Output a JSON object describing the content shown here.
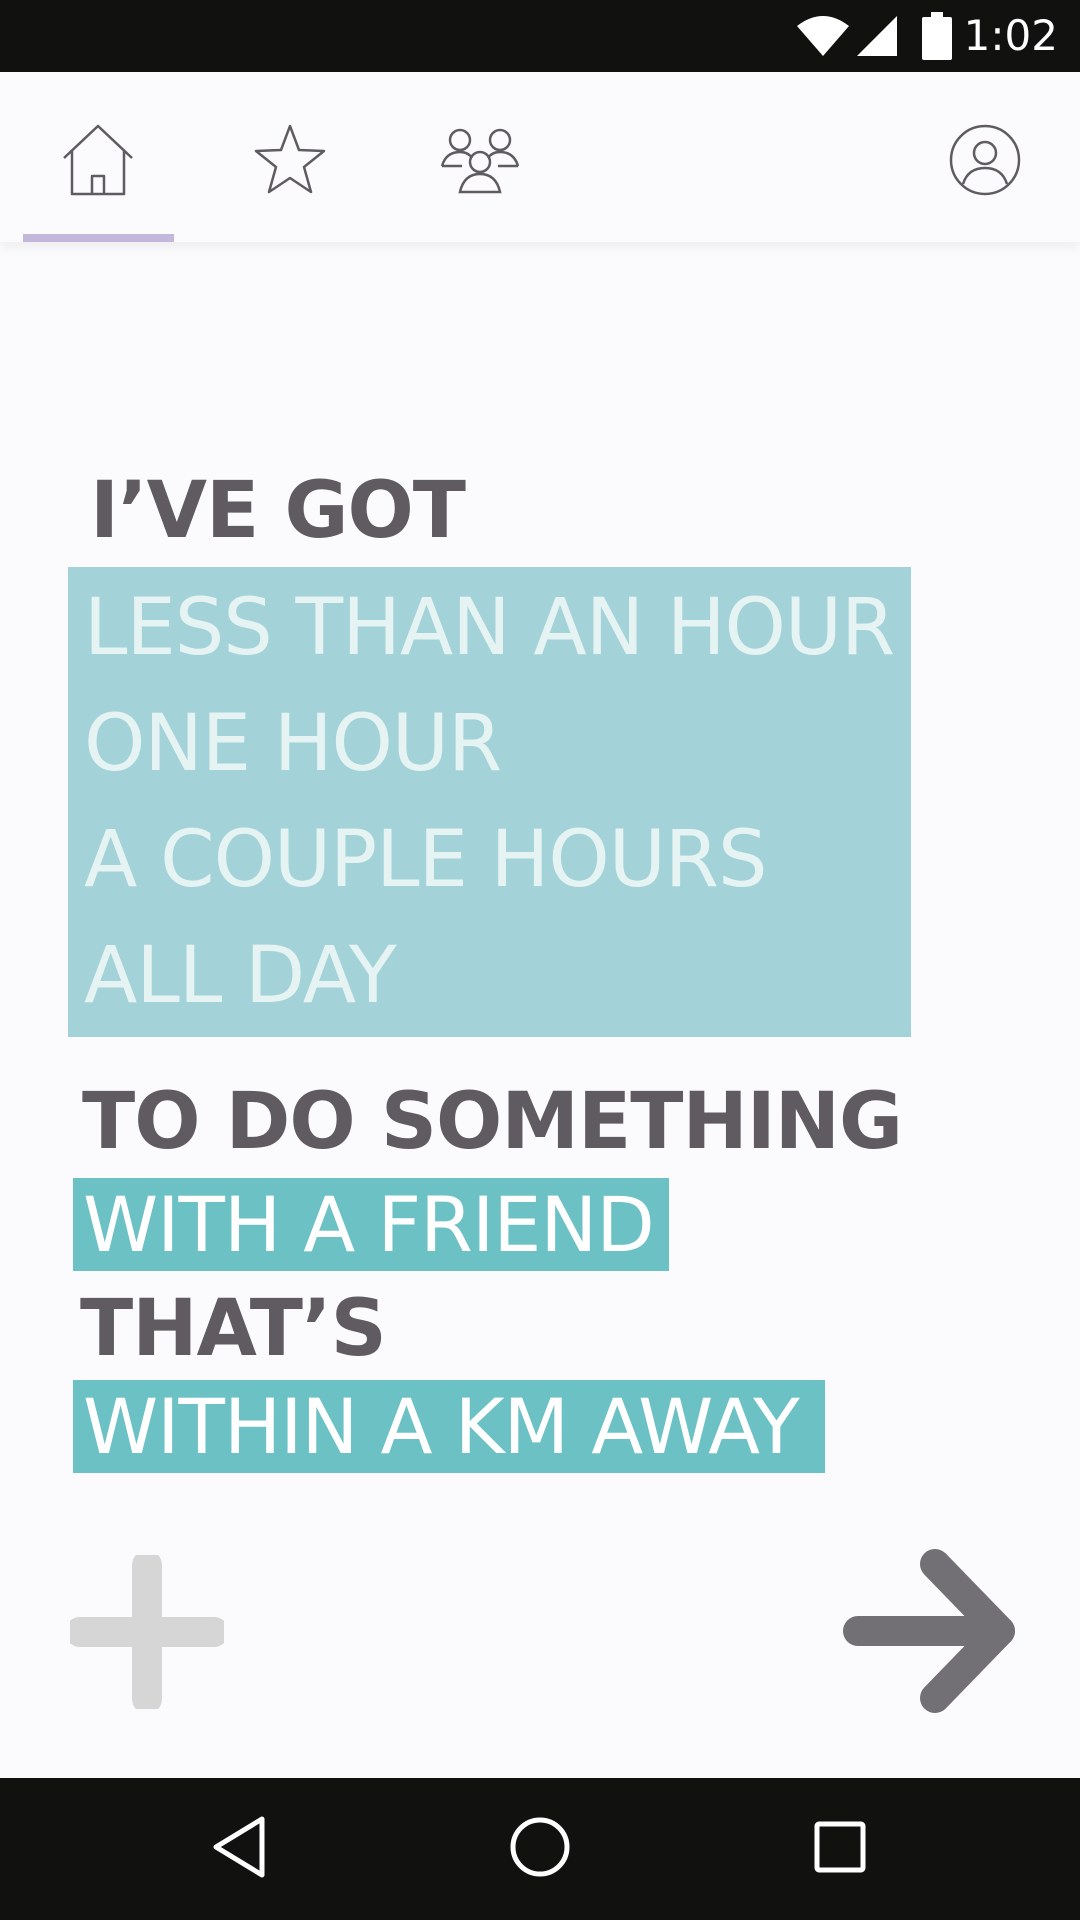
{
  "status_bar": {
    "time": "1:02",
    "icons": [
      "wifi-icon",
      "cellular-signal-icon",
      "battery-icon"
    ]
  },
  "top_nav": {
    "tabs": [
      {
        "icon": "home-icon",
        "active": true
      },
      {
        "icon": "star-icon",
        "active": false
      },
      {
        "icon": "group-icon",
        "active": false
      }
    ],
    "profile_icon": "profile-icon",
    "active_indicator_color": "#c3b8dc"
  },
  "main": {
    "heading_1": "I’VE GOT",
    "time_options": [
      "LESS THAN AN HOUR",
      "ONE HOUR",
      "A COUPLE HOURS",
      "ALL DAY"
    ],
    "heading_2": "TO DO SOMETHING",
    "companion_selection": "WITH A FRIEND",
    "heading_3": "THAT’S",
    "distance_selection": "WITHIN A KM AWAY",
    "add_icon": "plus-icon",
    "next_icon": "arrow-right-icon"
  },
  "nav_bar": {
    "icons": [
      "back-icon",
      "home-circle-icon",
      "recents-icon"
    ]
  },
  "colors": {
    "heading_text": "#5f5b61",
    "options_background": "#a3d3d8",
    "options_text": "#e6f3f3",
    "chip_background": "#6cc1c4",
    "chip_text": "#ffffff",
    "add_icon": "#d6d6d6",
    "next_icon": "#726f75"
  }
}
